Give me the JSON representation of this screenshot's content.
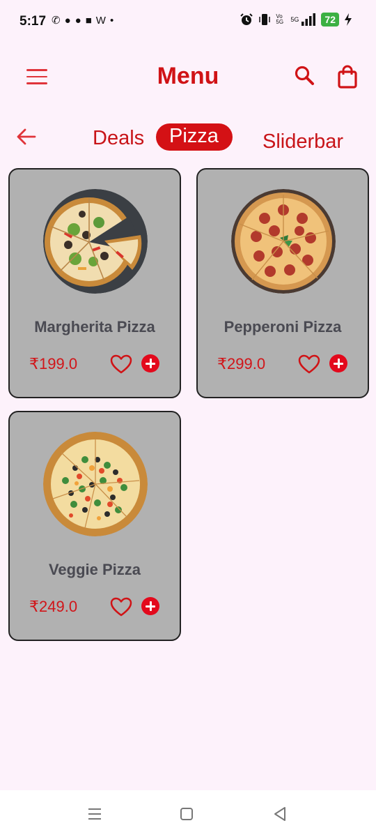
{
  "status_bar": {
    "time": "5:17",
    "left_icons": [
      "whatsapp-icon",
      "snapchat-icon",
      "snapchat-icon",
      "message-icon",
      "w-icon",
      "dot"
    ],
    "volte": "Vo 5G",
    "network": "5G",
    "battery": "72",
    "colors": {
      "battery": "#3cb043"
    }
  },
  "header": {
    "title": "Menu",
    "icons": [
      "hamburger-menu-icon",
      "search-icon",
      "shopping-bag-icon"
    ]
  },
  "tabs": {
    "items": [
      {
        "label": "Deals"
      },
      {
        "label": "Pizza",
        "active": true
      },
      {
        "label": "Sliderbar"
      }
    ]
  },
  "products": [
    {
      "name": "Margherita Pizza",
      "price": "₹199.0",
      "image": "margherita-pizza-photo"
    },
    {
      "name": "Pepperoni Pizza",
      "price": "₹299.0",
      "image": "pepperoni-pizza-photo"
    },
    {
      "name": "Veggie Pizza",
      "price": "₹249.0",
      "image": "veggie-pizza-photo"
    }
  ],
  "theme": {
    "accent": "#d01316",
    "card_bg": "#b1b1b1",
    "page_bg": "#fdf2fb"
  },
  "nav_bar": {
    "icons": [
      "recent-apps-icon",
      "home-icon",
      "back-icon"
    ]
  }
}
